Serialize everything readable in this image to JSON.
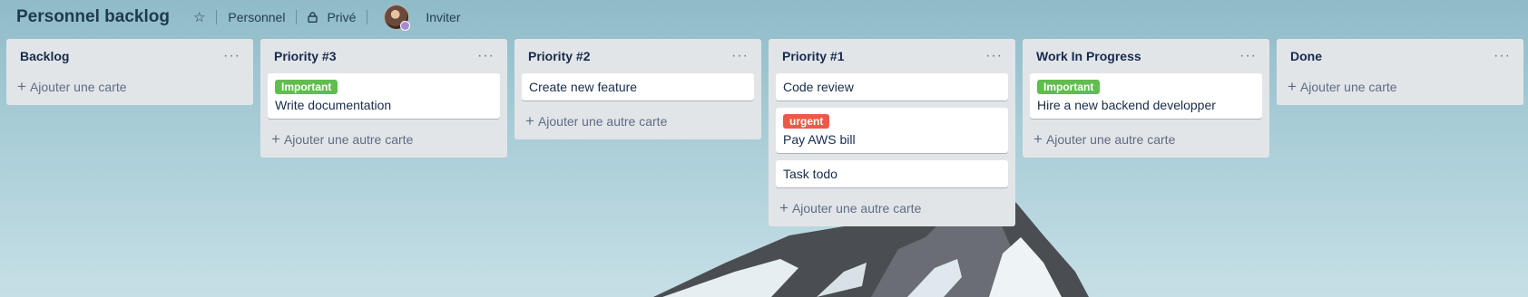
{
  "board": {
    "title": "Personnel backlog",
    "team": "Personnel",
    "visibility": "Privé",
    "invite": "Inviter"
  },
  "icons": [
    "star-icon",
    "lock-icon",
    "avatar",
    "more-icon",
    "plus-icon"
  ],
  "colors": {
    "label_green": "#61bd4f",
    "label_red": "#eb5a46",
    "list_bg": "#e2e5e8"
  },
  "lists": [
    {
      "title": "Backlog",
      "menu": "···",
      "add": "Ajouter une carte",
      "cards": []
    },
    {
      "title": "Priority #3",
      "menu": "···",
      "add": "Ajouter une autre carte",
      "cards": [
        {
          "label": "Important",
          "title": "Write documentation"
        }
      ]
    },
    {
      "title": "Priority #2",
      "menu": "···",
      "add": "Ajouter une autre carte",
      "cards": [
        {
          "title": "Create new feature"
        }
      ]
    },
    {
      "title": "Priority #1",
      "menu": "···",
      "add": "Ajouter une autre carte",
      "cards": [
        {
          "title": "Code review"
        },
        {
          "label": "urgent",
          "title": "Pay AWS bill"
        },
        {
          "title": "Task todo"
        }
      ]
    },
    {
      "title": "Work In Progress",
      "menu": "···",
      "add": "Ajouter une autre carte",
      "cards": [
        {
          "label": "Important",
          "title": "Hire a new backend developper"
        }
      ]
    },
    {
      "title": "Done",
      "menu": "···",
      "add": "Ajouter une carte",
      "cards": []
    }
  ]
}
